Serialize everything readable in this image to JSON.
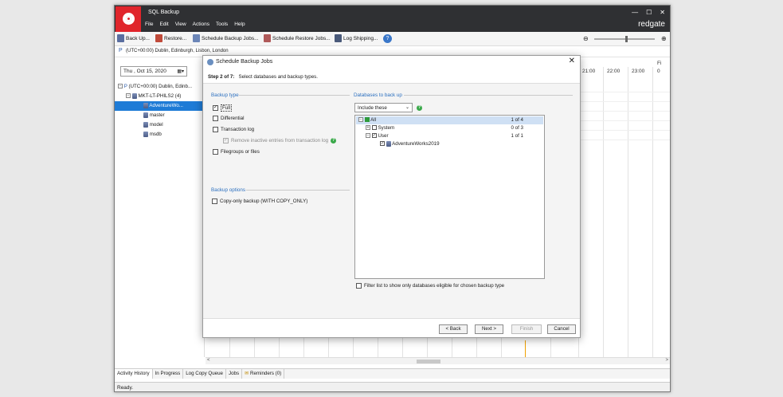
{
  "app": {
    "title": "SQL Backup",
    "brand": "redgate",
    "menu": [
      "File",
      "Edit",
      "View",
      "Actions",
      "Tools",
      "Help"
    ],
    "window_controls": [
      "—",
      "☐",
      "✕"
    ]
  },
  "toolbar": {
    "backup_up": "Back Up...",
    "restore": "Restore...",
    "schedule_backup": "Schedule Backup Jobs...",
    "schedule_restore": "Schedule Restore Jobs...",
    "log_shipping": "Log Shipping..."
  },
  "timezone": "(UTC+00:00) Dublin, Edinburgh, Lisbon, London",
  "date_picker": {
    "value": "Thu , Oct 15, 2020"
  },
  "server_tree": {
    "root": "(UTC+00:00) Dublin, Edinb...",
    "server": "MKT-LT-PHILS2 (4)",
    "databases": [
      "AdventureWo...",
      "master",
      "model",
      "msdb"
    ]
  },
  "timeline": {
    "hours": [
      "21:00",
      "22:00",
      "23:00",
      "0"
    ],
    "corner_label": "Fi"
  },
  "bottom_tabs": [
    "Activity History",
    "In Progress",
    "Log Copy Queue",
    "Jobs",
    "Reminders (0)"
  ],
  "status": "Ready.",
  "dialog": {
    "title": "Schedule Backup Jobs",
    "close": "✕",
    "step_label": "Step 2 of 7:",
    "step_desc": "Select databases and backup types.",
    "backup_type_title": "Backup type",
    "backup_types": {
      "full": "Full",
      "differential": "Differential",
      "transaction_log": "Transaction log",
      "remove_inactive": "Remove inactive entries from transaction log",
      "filegroups": "Filegroups or files"
    },
    "backup_options_title": "Backup options",
    "copy_only": "Copy-only backup (WITH COPY_ONLY)",
    "databases_title": "Databases to back up",
    "include_select": "Include these",
    "db_tree": {
      "all": {
        "label": "All",
        "count": "1 of 4"
      },
      "system": {
        "label": "System",
        "count": "0 of 3"
      },
      "user": {
        "label": "User",
        "count": "1 of 1"
      },
      "db": "AdventureWorks2019"
    },
    "filter_label": "Filter list to show only databases eligible for chosen backup type",
    "buttons": {
      "back": "< Back",
      "next": "Next >",
      "finish": "Finish",
      "cancel": "Cancel"
    }
  },
  "colors": {
    "accent": "#1e7bd6",
    "brand_red": "#e0252b",
    "titlebar": "#2f3033",
    "section": "#2b6fbf"
  }
}
